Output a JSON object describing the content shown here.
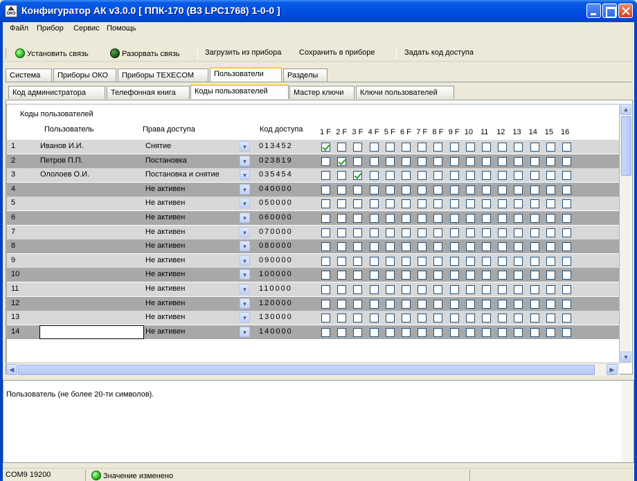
{
  "window": {
    "title": "Конфигуратор АК v3.0.0 [ ППК-170 (В3 LPC1768) 1-0-0 ]",
    "app_icon_text": "ОКО"
  },
  "menu": [
    "Файл",
    "Прибор",
    "Сервис",
    "Помощь"
  ],
  "toolbar": {
    "connect": "Установить связь",
    "disconnect": "Разорвать связь",
    "load": "Загрузить из прибора",
    "save": "Сохранить в приборе",
    "access_code": "Задать код доступа"
  },
  "main_tabs": [
    "Система",
    "Приборы ОКО",
    "Приборы TEXECOM",
    "Пользователи",
    "Разделы"
  ],
  "main_tab_active": "Пользователи",
  "sub_tabs": [
    "Код администратора",
    "Телефонная книга",
    "Коды пользователей",
    "Мастер ключи",
    "Ключи пользователей"
  ],
  "sub_tab_active": "Коды пользователей",
  "grid": {
    "caption": "Коды пользователей",
    "headers": {
      "user": "Пользователь",
      "rights": "Права доступа",
      "code": "Код доступа",
      "flags": [
        "1 F",
        "2 F",
        "3 F",
        "4 F",
        "5 F",
        "6 F",
        "7 F",
        "8 F",
        "9 F",
        "10",
        "11",
        "12",
        "13",
        "14",
        "15",
        "16"
      ]
    },
    "rows": [
      {
        "num": "1",
        "user": "Иванов И.И.",
        "rights": "Снятие",
        "code": "013452",
        "checked": [
          0
        ]
      },
      {
        "num": "2",
        "user": "Петров П.П.",
        "rights": "Постановка",
        "code": "023819",
        "checked": [
          1
        ]
      },
      {
        "num": "3",
        "user": "Ололоев О.И.",
        "rights": "Постановка и снятие",
        "code": "035454",
        "checked": [
          2
        ]
      },
      {
        "num": "4",
        "user": "",
        "rights": "Не активен",
        "code": "040000",
        "checked": []
      },
      {
        "num": "5",
        "user": "",
        "rights": "Не активен",
        "code": "050000",
        "checked": []
      },
      {
        "num": "6",
        "user": "",
        "rights": "Не активен",
        "code": "060000",
        "checked": []
      },
      {
        "num": "7",
        "user": "",
        "rights": "Не активен",
        "code": "070000",
        "checked": []
      },
      {
        "num": "8",
        "user": "",
        "rights": "Не активен",
        "code": "080000",
        "checked": []
      },
      {
        "num": "9",
        "user": "",
        "rights": "Не активен",
        "code": "090000",
        "checked": []
      },
      {
        "num": "10",
        "user": "",
        "rights": "Не активен",
        "code": "100000",
        "checked": []
      },
      {
        "num": "11",
        "user": "",
        "rights": "Не активен",
        "code": "110000",
        "checked": []
      },
      {
        "num": "12",
        "user": "",
        "rights": "Не активен",
        "code": "120000",
        "checked": []
      },
      {
        "num": "13",
        "user": "",
        "rights": "Не активен",
        "code": "130000",
        "checked": []
      },
      {
        "num": "14",
        "user": "",
        "rights": "Не активен",
        "code": "140000",
        "checked": []
      }
    ]
  },
  "description": "Пользователь (не более 20-ти символов).",
  "status": {
    "port": "COM9 19200",
    "message": "Значение изменено"
  },
  "colors": {
    "titlebar": "#0050e0",
    "row_light": "#d8d8d8",
    "row_dark": "#a8a8a8",
    "tab_active_accent": "#ffc83c",
    "check": "#21a121"
  }
}
